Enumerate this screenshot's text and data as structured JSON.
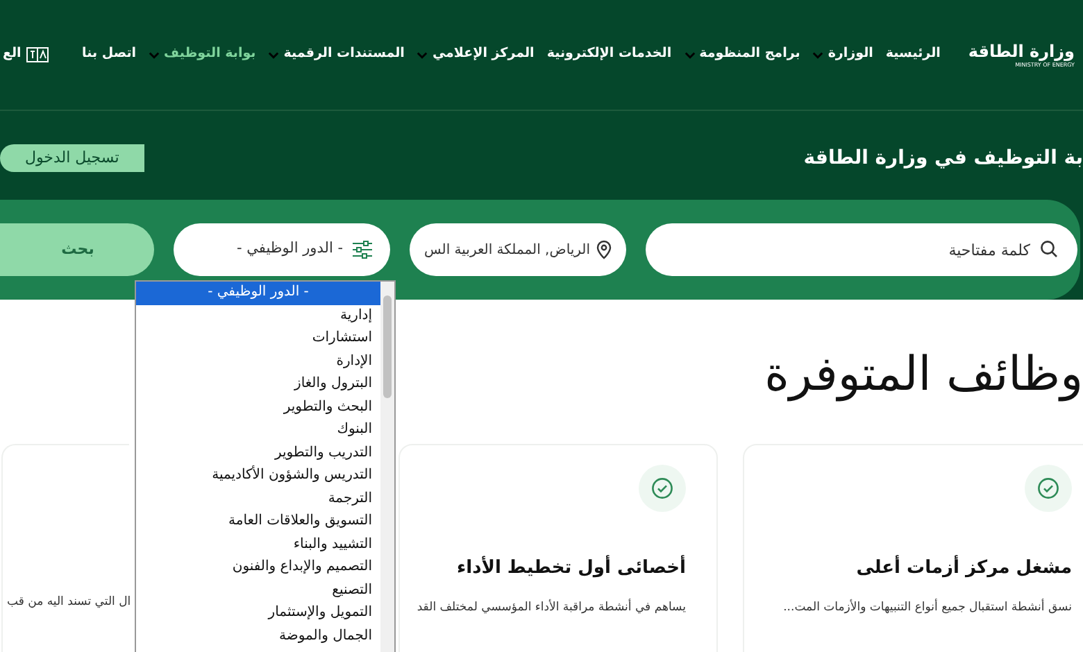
{
  "header": {
    "logo": {
      "title": "وزارة الطاقة",
      "subtitle": "MINISTRY OF ENERGY"
    },
    "nav": [
      {
        "label": "الرئيسية",
        "dropdown": false,
        "selected": false
      },
      {
        "label": "الوزارة",
        "dropdown": true,
        "selected": false
      },
      {
        "label": "برامج المنظومة",
        "dropdown": true,
        "selected": false
      },
      {
        "label": "الخدمات الإلكترونية",
        "dropdown": false,
        "selected": false
      },
      {
        "label": "المركز الإعلامي",
        "dropdown": true,
        "selected": false
      },
      {
        "label": "المستندات الرقمية",
        "dropdown": true,
        "selected": false
      },
      {
        "label": "بوابة التوظيف",
        "dropdown": true,
        "selected": true
      },
      {
        "label": "اتصل بنا",
        "dropdown": false,
        "selected": false
      }
    ],
    "language": "الع"
  },
  "hero": {
    "title": "بة التوظيف في وزارة الطاقة",
    "login_button": "تسجيل الدخول"
  },
  "search": {
    "keyword_placeholder": "كلمة مفتاحية",
    "location": "الرياض, المملكة العربية الس",
    "role_select": "- الدور الوظيفي -",
    "search_button": "بحث"
  },
  "role_options": [
    {
      "label": "- الدور الوظيفي -",
      "selected": true
    },
    {
      "label": "إدارية",
      "selected": false
    },
    {
      "label": "استشارات",
      "selected": false
    },
    {
      "label": "الإدارة",
      "selected": false
    },
    {
      "label": "البترول والغاز",
      "selected": false
    },
    {
      "label": "البحث والتطوير",
      "selected": false
    },
    {
      "label": "البنوك",
      "selected": false
    },
    {
      "label": "التدريب والتطوير",
      "selected": false
    },
    {
      "label": "التدريس والشؤون الأكاديمية",
      "selected": false
    },
    {
      "label": "الترجمة",
      "selected": false
    },
    {
      "label": "التسويق والعلاقات العامة",
      "selected": false
    },
    {
      "label": "التشييد والبناء",
      "selected": false
    },
    {
      "label": "التصميم والإبداع والفنون",
      "selected": false
    },
    {
      "label": "التصنيع",
      "selected": false
    },
    {
      "label": "التمويل والإستثمار",
      "selected": false
    },
    {
      "label": "الجمال والموضة",
      "selected": false
    }
  ],
  "jobs_heading": "وظائف المتوفرة",
  "jobs": [
    {
      "title": "مشغل مركز أزمات أعلى",
      "description": "نسق أنشطة استقبال جميع أنواع التنبيهات والأزمات المت..."
    },
    {
      "title": "أخصائى أول تخطيط الأداء",
      "description": "يساهم في أنشطة مراقبة الأداء المؤسسي لمختلف القد"
    },
    {
      "description": "ال التي تسند اليه من قب"
    }
  ]
}
